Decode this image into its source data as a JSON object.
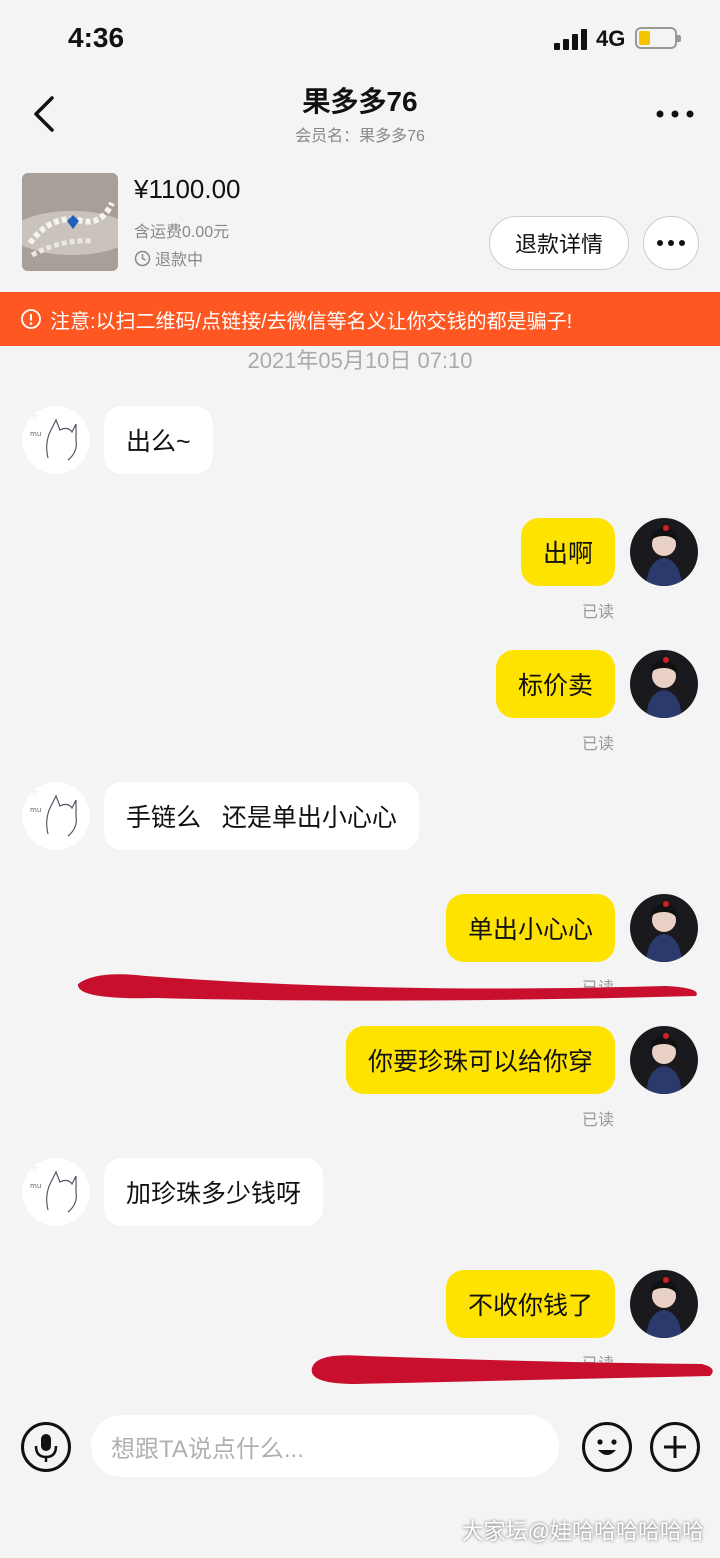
{
  "status": {
    "time": "4:36",
    "network": "4G"
  },
  "header": {
    "title": "果多多76",
    "subtitle": "会员名：果多多76"
  },
  "product": {
    "price": "¥1100.00",
    "shipping": "含运费0.00元",
    "status": "退款中",
    "refund_button": "退款详情"
  },
  "warning": {
    "text": "注意:以扫二维码/点链接/去微信等名义让你交钱的都是骗子!"
  },
  "chat": {
    "timestamp": "2021年05月10日 07:10",
    "messages": [
      {
        "side": "in",
        "text": "出么~"
      },
      {
        "side": "out",
        "text": "出啊",
        "status": "已读"
      },
      {
        "side": "out",
        "text": "标价卖",
        "status": "已读"
      },
      {
        "side": "in",
        "text": "手链么   还是单出小心心"
      },
      {
        "side": "out",
        "text": "单出小心心",
        "status": "已读"
      },
      {
        "side": "out",
        "text": "你要珍珠可以给你穿",
        "status": "已读"
      },
      {
        "side": "in",
        "text": "加珍珠多少钱呀"
      },
      {
        "side": "out",
        "text": "不收你钱了",
        "status": "已读"
      }
    ]
  },
  "input": {
    "placeholder": "想跟TA说点什么..."
  },
  "watermark": "大家坛@娃哈哈哈哈哈哈",
  "colors": {
    "bubble_out": "#ffe300",
    "warning": "#ff5722",
    "scribble": "#c8102e"
  },
  "icons": [
    "back-icon",
    "more-icon",
    "clock-icon",
    "warning-icon",
    "mic-icon",
    "emoji-icon",
    "add-icon"
  ]
}
